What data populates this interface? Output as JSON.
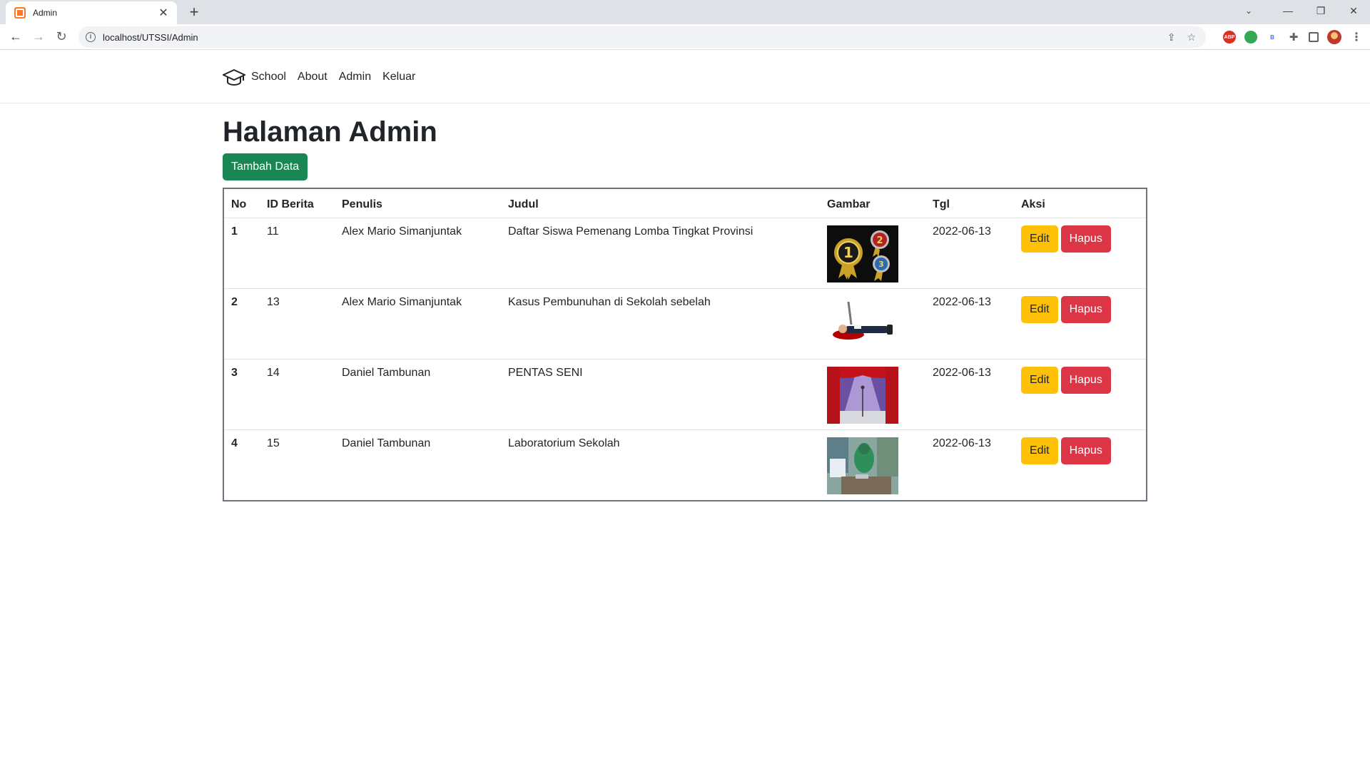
{
  "browser": {
    "tab_title": "Admin",
    "url": "localhost/UTSSI/Admin",
    "extensions": [
      "ABP",
      "globe",
      "B"
    ]
  },
  "nav": {
    "brand": "School",
    "links": [
      "About",
      "Admin",
      "Keluar"
    ]
  },
  "main": {
    "title": "Halaman Admin",
    "add_button": "Tambah Data",
    "table": {
      "headers": [
        "No",
        "ID Berita",
        "Penulis",
        "Judul",
        "Gambar",
        "Tgl",
        "Aksi"
      ],
      "rows": [
        {
          "no": "1",
          "id": "11",
          "penulis": "Alex Mario Simanjuntak",
          "judul": "Daftar Siswa Pemenang Lomba Tingkat Provinsi",
          "gambar": "medals-image",
          "tgl": "2022-06-13",
          "edit": "Edit",
          "hapus": "Hapus"
        },
        {
          "no": "2",
          "id": "13",
          "penulis": "Alex Mario Simanjuntak",
          "judul": "Kasus Pembunuhan di Sekolah sebelah",
          "gambar": "crime-scene-image",
          "tgl": "2022-06-13",
          "edit": "Edit",
          "hapus": "Hapus"
        },
        {
          "no": "3",
          "id": "14",
          "penulis": "Daniel Tambunan",
          "judul": "PENTAS SENI",
          "gambar": "stage-image",
          "tgl": "2022-06-13",
          "edit": "Edit",
          "hapus": "Hapus"
        },
        {
          "no": "4",
          "id": "15",
          "penulis": "Daniel Tambunan",
          "judul": "Laboratorium Sekolah",
          "gambar": "laboratory-image",
          "tgl": "2022-06-13",
          "edit": "Edit",
          "hapus": "Hapus"
        }
      ]
    }
  },
  "colors": {
    "success": "#198754",
    "warning": "#ffc107",
    "danger": "#dc3545"
  }
}
